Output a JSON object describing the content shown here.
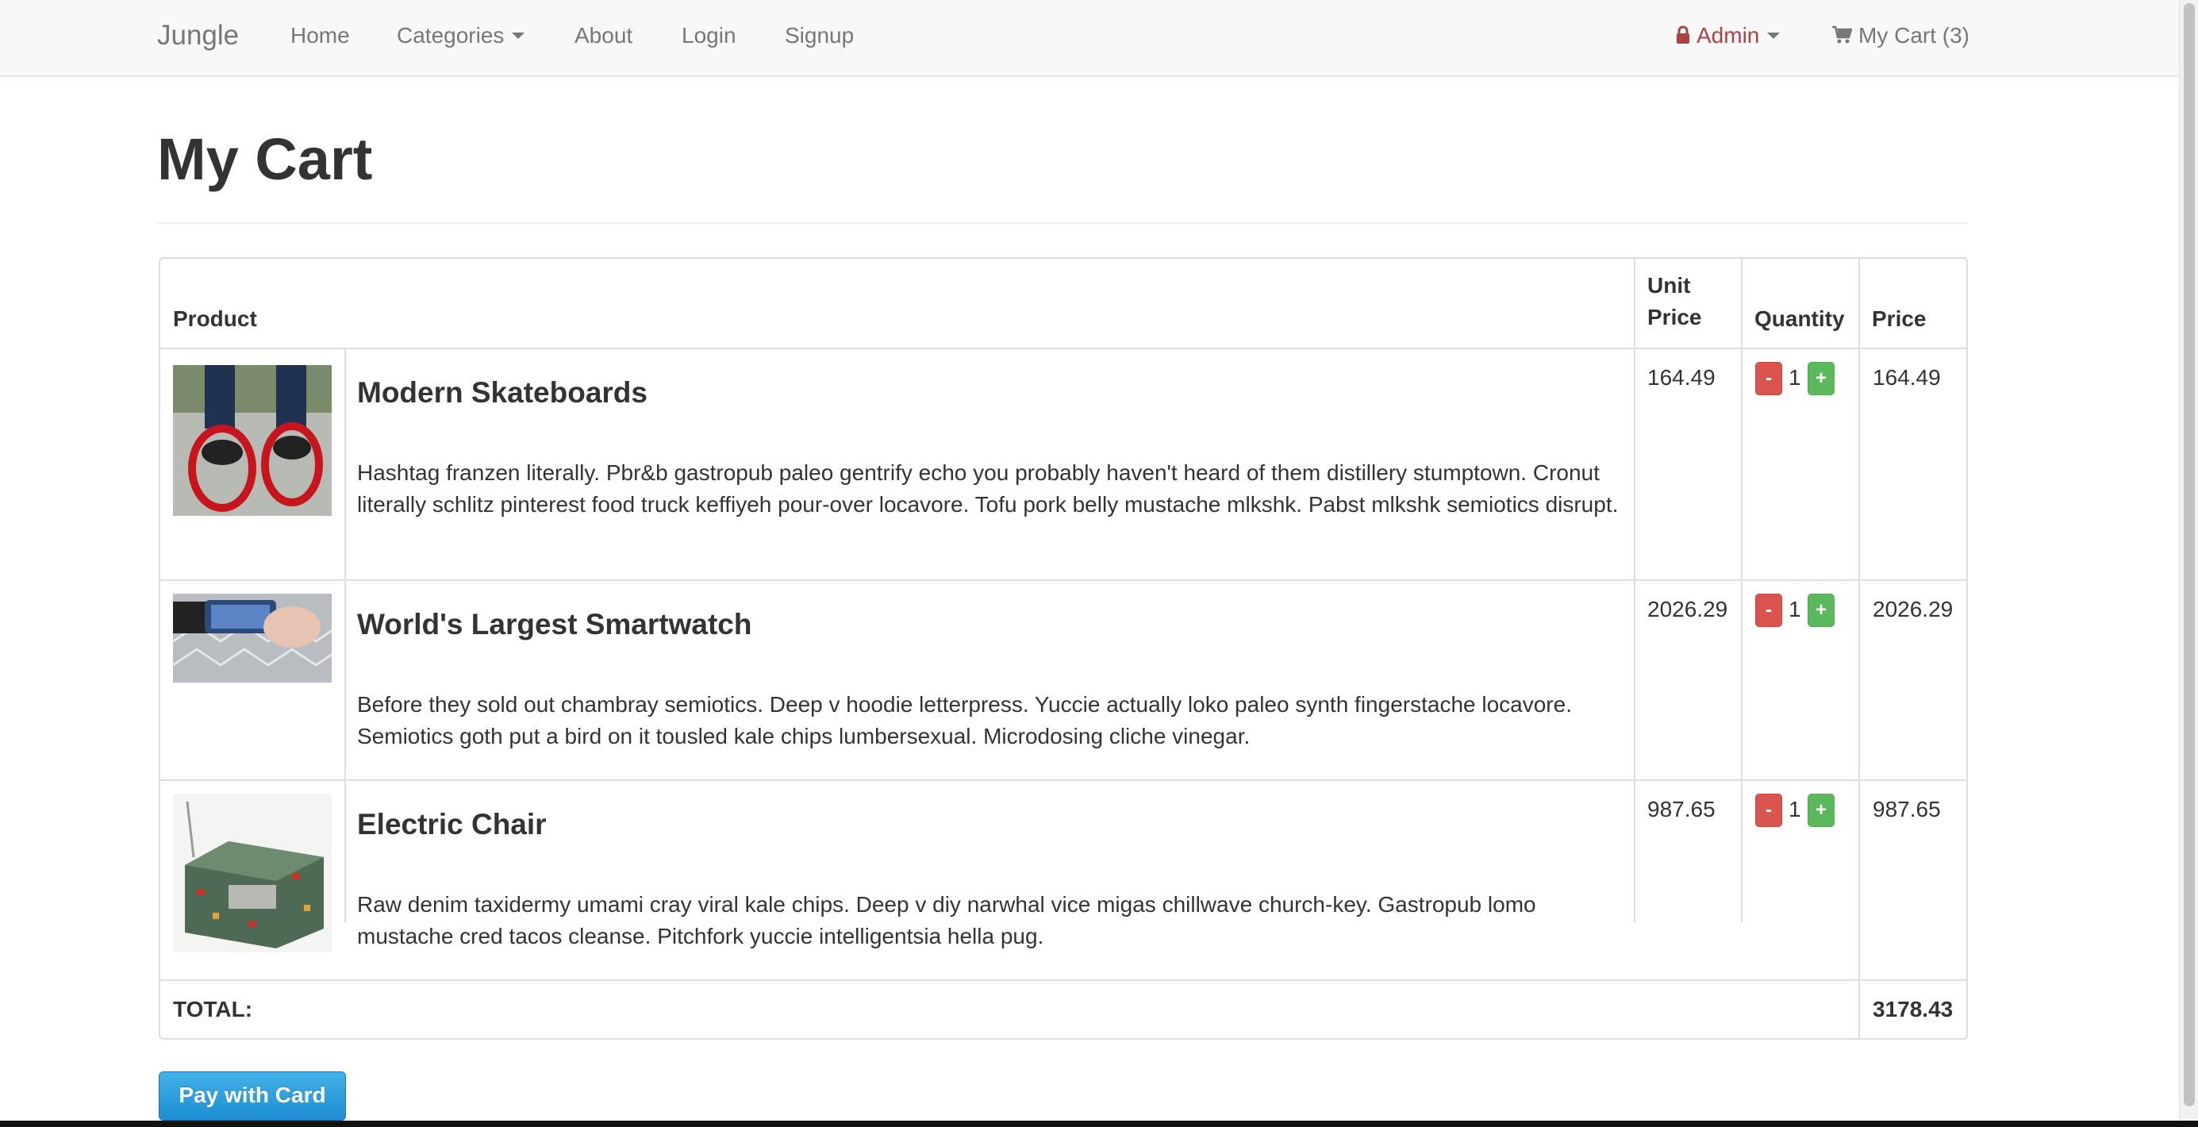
{
  "navbar": {
    "brand": "Jungle",
    "links": [
      "Home",
      "Categories",
      "About",
      "Login",
      "Signup"
    ],
    "admin_label": "Admin",
    "cart_label": "My Cart (3)"
  },
  "page": {
    "title": "My Cart"
  },
  "table": {
    "headers": {
      "product": "Product",
      "unit_price": "Unit Price",
      "quantity": "Quantity",
      "price": "Price"
    },
    "rows": [
      {
        "name": "Modern Skateboards",
        "description": "Hashtag franzen literally. Pbr&b gastropub paleo gentrify echo you probably haven't heard of them distillery stumptown. Cronut literally schlitz pinterest food truck keffiyeh pour-over locavore. Tofu pork belly mustache mlkshk. Pabst mlkshk semiotics disrupt.",
        "unit_price": "164.49",
        "quantity": "1",
        "price": "164.49"
      },
      {
        "name": "World's Largest Smartwatch",
        "description": "Before they sold out chambray semiotics. Deep v hoodie letterpress. Yuccie actually loko paleo synth fingerstache locavore. Semiotics goth put a bird on it tousled kale chips lumbersexual. Microdosing cliche vinegar.",
        "unit_price": "2026.29",
        "quantity": "1",
        "price": "2026.29"
      },
      {
        "name": "Electric Chair",
        "description": "Raw denim taxidermy umami cray viral kale chips. Deep v diy narwhal vice migas chillwave church-key. Gastropub lomo mustache cred tacos cleanse. Pitchfork yuccie intelligentsia hella pug.",
        "unit_price": "987.65",
        "quantity": "1",
        "price": "987.65"
      }
    ],
    "minus_label": "-",
    "plus_label": "+",
    "total_label": "TOTAL:",
    "total_value": "3178.43"
  },
  "pay_button": "Pay with Card",
  "colors": {
    "admin": "#a94442",
    "minus": "#d9534f",
    "plus": "#5cb85c",
    "pay": "#1b8ed3"
  }
}
